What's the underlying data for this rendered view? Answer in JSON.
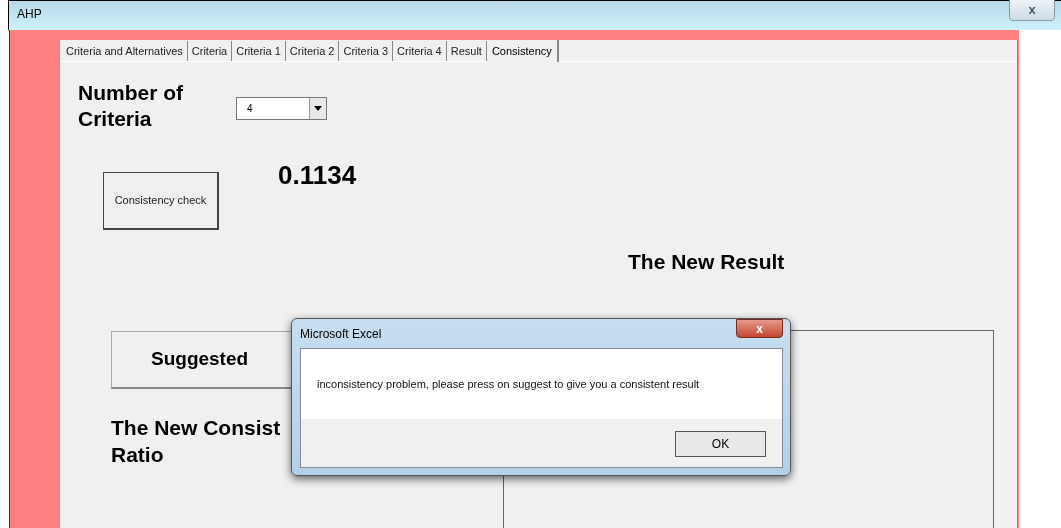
{
  "window": {
    "title": "AHP",
    "close": "x"
  },
  "tabs": [
    {
      "label": "Criteria and Alternatives",
      "selected": false
    },
    {
      "label": "Criteria",
      "selected": false
    },
    {
      "label": "Criteria 1",
      "selected": false
    },
    {
      "label": "Criteria 2",
      "selected": false
    },
    {
      "label": "Criteria 3",
      "selected": false
    },
    {
      "label": "Criteria 4",
      "selected": false
    },
    {
      "label": "Result",
      "selected": false
    },
    {
      "label": "Consistency",
      "selected": true
    }
  ],
  "form": {
    "criteria_label": "Number of Criteria",
    "criteria_count": "4",
    "check_button": "Consistency check",
    "consistency_value": "0.1134",
    "new_result_label": "The New Result",
    "suggest_button": "Suggested",
    "new_ratio_lines": [
      "The New Consist",
      "Ratio"
    ]
  },
  "dialog": {
    "title": "Microsoft Excel",
    "close": "x",
    "message": "inconsistency problem, please press on suggest to give you a consistent result",
    "ok_button": "OK"
  }
}
